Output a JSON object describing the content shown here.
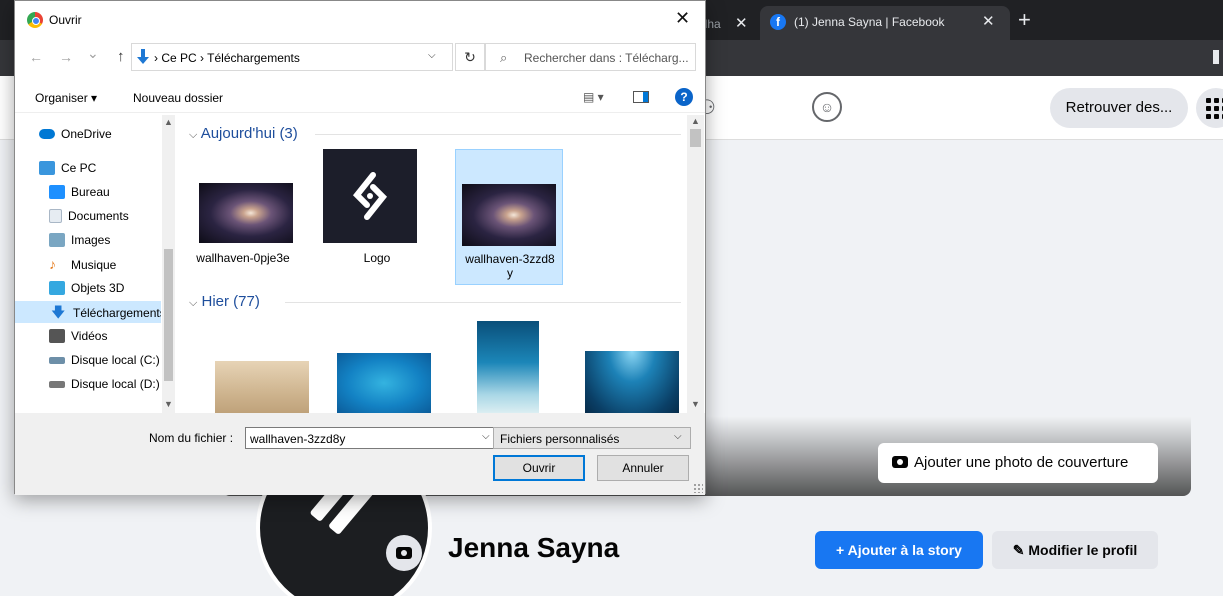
{
  "browser": {
    "tab_partial": {
      "label": "llha",
      "close": "✕"
    },
    "tab_active": {
      "favicon": "f",
      "title": "(1) Jenna Sayna | Facebook",
      "close": "✕"
    },
    "new_tab": "+"
  },
  "facebook": {
    "header": {
      "find_friends_label": "Retrouver des..."
    },
    "cover": {
      "add_cover_label": "Ajouter une photo de couverture"
    },
    "profile": {
      "name": "Jenna Sayna",
      "add_story_label": "+ Ajouter à la story",
      "edit_profile_label": "✎ Modifier le profil"
    },
    "colors": {
      "primary": "#1877f2",
      "surface": "#e4e6eb"
    }
  },
  "dialog": {
    "title": "Ouvrir",
    "close": "✕",
    "nav": {
      "back": "←",
      "forward": "→",
      "recent": "⌄",
      "up": "↑",
      "path": [
        "Ce PC",
        "Téléchargements"
      ],
      "path_sep": "›",
      "refresh": "↻",
      "search_placeholder": "Rechercher dans : Télécharg..."
    },
    "toolbar": {
      "organize_label": "Organiser ▾",
      "new_folder_label": "Nouveau dossier",
      "view_label": "▤ ▾",
      "help": "?"
    },
    "nav_pane": {
      "items": [
        {
          "label": "OneDrive",
          "icon": "cloud-icon",
          "color": "#0078d4"
        },
        {
          "label": "Ce PC",
          "icon": "pc-icon",
          "color": "#3a96dd"
        },
        {
          "label": "Bureau",
          "icon": "desktop-icon",
          "color": "#1e90ff"
        },
        {
          "label": "Documents",
          "icon": "documents-icon",
          "color": "#a9b7c6"
        },
        {
          "label": "Images",
          "icon": "images-icon",
          "color": "#7aa6c2"
        },
        {
          "label": "Musique",
          "icon": "music-icon",
          "color": "#e67e22"
        },
        {
          "label": "Objets 3D",
          "icon": "cube-icon",
          "color": "#35a8e0"
        },
        {
          "label": "Téléchargements",
          "icon": "download-icon",
          "color": "#1e78d4"
        },
        {
          "label": "Vidéos",
          "icon": "video-icon",
          "color": "#555555"
        },
        {
          "label": "Disque local (C:)",
          "icon": "drive-c-icon",
          "color": "#6d8fa8"
        },
        {
          "label": "Disque local (D:)",
          "icon": "drive-d-icon",
          "color": "#777777"
        }
      ],
      "selected": "Téléchargements"
    },
    "groups": [
      {
        "header": "Aujourd'hui (3)",
        "chevron": "⌵"
      },
      {
        "header": "Hier (77)",
        "chevron": "⌵"
      }
    ],
    "files_today": [
      {
        "name": "wallhaven-0pje3e"
      },
      {
        "name": "Logo"
      },
      {
        "name": "wallhaven-3zzd8\ny",
        "selected": true
      }
    ],
    "filename_label": "Nom du fichier :",
    "filename_value": "wallhaven-3zzd8y",
    "filetype_value": "Fichiers personnalisés",
    "open_label": "Ouvrir",
    "cancel_label": "Annuler"
  }
}
